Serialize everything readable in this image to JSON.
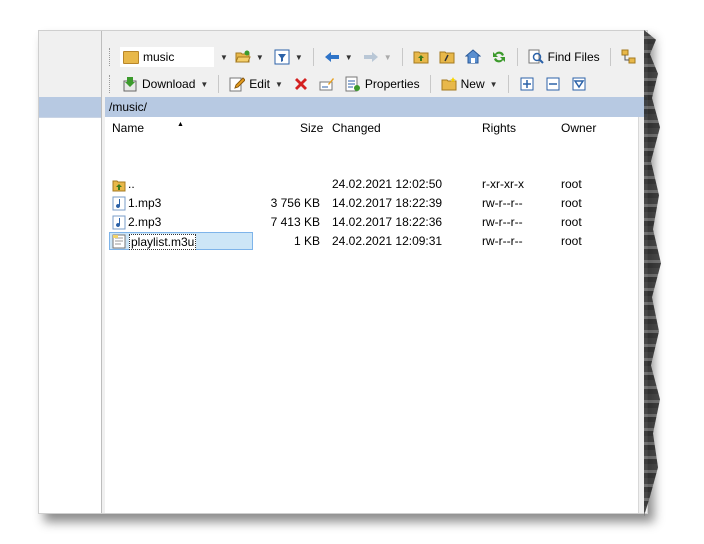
{
  "toolbar1": {
    "location": "music",
    "find_files": "Find Files"
  },
  "toolbar2": {
    "download": "Download",
    "edit": "Edit",
    "properties": "Properties",
    "new": "New"
  },
  "path": "/music/",
  "columns": {
    "name": "Name",
    "size": "Size",
    "changed": "Changed",
    "rights": "Rights",
    "owner": "Owner"
  },
  "files": [
    {
      "name": "..",
      "size": "",
      "changed": "24.02.2021 12:02:50",
      "rights": "r-xr-xr-x",
      "owner": "root",
      "icon": "parent-folder-icon"
    },
    {
      "name": "1.mp3",
      "size": "3 756 KB",
      "changed": "14.02.2017 18:22:39",
      "rights": "rw-r--r--",
      "owner": "root",
      "icon": "audio-file-icon"
    },
    {
      "name": "2.mp3",
      "size": "7 413 KB",
      "changed": "14.02.2017 18:22:36",
      "rights": "rw-r--r--",
      "owner": "root",
      "icon": "audio-file-icon"
    },
    {
      "name": "playlist.m3u",
      "size": "1 KB",
      "changed": "24.02.2021 12:09:31",
      "rights": "rw-r--r--",
      "owner": "root",
      "icon": "playlist-file-icon"
    }
  ],
  "colors": {
    "path_bar": "#b7c9e2",
    "selection": "#cde6f7"
  }
}
